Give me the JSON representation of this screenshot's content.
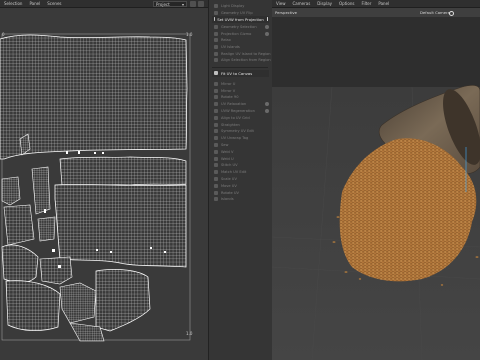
{
  "uv_editor": {
    "menu": [
      "Selection",
      "Panel",
      "Scenes"
    ],
    "projection_dropdown": "Project",
    "ticks": {
      "top_right": "1.0",
      "left_top": "0",
      "bottom_right": "1.0"
    }
  },
  "tools": {
    "top": [
      {
        "label": "Light Display",
        "active": false,
        "dot": false
      },
      {
        "label": "Geometry UV Flip",
        "active": false,
        "dot": false
      },
      {
        "label": "Set UVW from Projection",
        "active": true,
        "section": true,
        "dot": true
      },
      {
        "label": "Geometry Selection",
        "active": false,
        "dot": true
      },
      {
        "label": "Projection Gizmo",
        "active": false,
        "dot": true
      },
      {
        "label": "Relax",
        "active": false,
        "dot": false
      },
      {
        "label": "UV Islands",
        "active": false,
        "dot": false
      },
      {
        "label": "Realign UV Island to Region",
        "active": false,
        "dot": false
      },
      {
        "label": "Align Selection from Region",
        "active": false,
        "dot": false
      }
    ],
    "section2": {
      "label": "Fit UV to Canvas"
    },
    "bottom": [
      {
        "label": "Mirror U",
        "dot": false
      },
      {
        "label": "Mirror V",
        "dot": false
      },
      {
        "label": "Rotate 90",
        "dot": false
      },
      {
        "label": "UV Relaxation",
        "dot": true
      },
      {
        "label": "UVW Regeneration",
        "dot": true
      },
      {
        "label": "Align to UV Grid",
        "dot": false
      },
      {
        "label": "Straighten",
        "dot": false
      },
      {
        "label": "Symmetry UV Edit",
        "dot": false
      },
      {
        "label": "UV Unwrap Tag",
        "dot": false
      },
      {
        "label": "Sew",
        "dot": false
      },
      {
        "label": "Weld V",
        "dot": false
      },
      {
        "label": "Weld U",
        "dot": false
      },
      {
        "label": "Stitch UV",
        "dot": false
      },
      {
        "label": "Match UV Edit",
        "dot": false
      },
      {
        "label": "Scale UV",
        "dot": false
      },
      {
        "label": "Move UV",
        "dot": false
      },
      {
        "label": "Rotate UV",
        "dot": false
      },
      {
        "label": "Islands",
        "dot": false
      }
    ]
  },
  "viewport": {
    "menu": [
      "View",
      "Cameras",
      "Display",
      "Options",
      "Filter",
      "Panel"
    ],
    "view_name": "Perspective",
    "camera_name": "Default Camera"
  },
  "colors": {
    "uv_wire": "#d9d9d9",
    "uv_bg": "#3a3a3a",
    "grain": "#b07a3c",
    "sack": "#6a5a48"
  }
}
